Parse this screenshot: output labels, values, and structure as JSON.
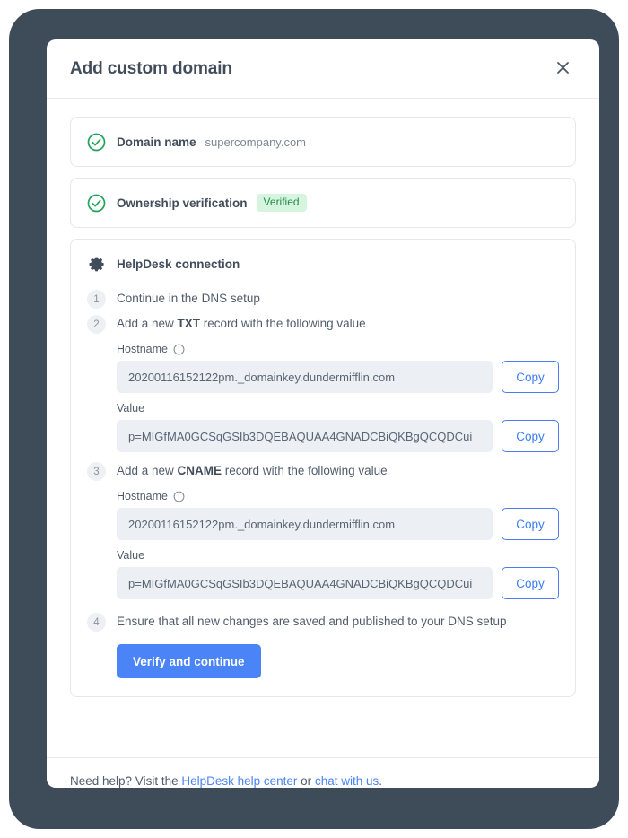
{
  "modal": {
    "title": "Add custom domain",
    "close_icon": "close-icon"
  },
  "summary": [
    {
      "icon": "check-circle-icon",
      "label": "Domain name",
      "value": "supercompany.com"
    },
    {
      "icon": "check-circle-icon",
      "label": "Ownership verification",
      "badge": "Verified"
    }
  ],
  "connection": {
    "icon": "gear-icon",
    "title": "HelpDesk connection",
    "steps": [
      {
        "num": "1",
        "text_before": "Continue in the DNS setup",
        "strong": "",
        "text_after": ""
      },
      {
        "num": "2",
        "text_before": "Add a new ",
        "strong": "TXT",
        "text_after": " record with the following value"
      },
      {
        "num": "3",
        "text_before": "Add a new ",
        "strong": "CNAME",
        "text_after": " record with the following value"
      },
      {
        "num": "4",
        "text_before": "Ensure that all new changes are saved and published to your DNS setup",
        "strong": "",
        "text_after": ""
      }
    ],
    "txt_record": {
      "hostname_label": "Hostname",
      "hostname_value": "20200116152122pm._domainkey.dundermifflin.com",
      "value_label": "Value",
      "value_value": "p=MIGfMA0GCSqGSIb3DQEBAQUAA4GNADCBiQKBgQCQDCui",
      "copy_label": "Copy",
      "info_icon": "info-icon"
    },
    "cname_record": {
      "hostname_label": "Hostname",
      "hostname_value": "20200116152122pm._domainkey.dundermifflin.com",
      "value_label": "Value",
      "value_value": "p=MIGfMA0GCSqGSIb3DQEBAQUAA4GNADCBiQKBgQCQDCui",
      "copy_label": "Copy",
      "info_icon": "info-icon"
    },
    "verify_button": "Verify and continue"
  },
  "footer": {
    "text_start": "Need help? Visit the ",
    "link_help_center": "HelpDesk help center",
    "text_middle": " or ",
    "link_chat": "chat with us",
    "text_end": "."
  },
  "colors": {
    "accent_blue": "#4a84f7",
    "success_green": "#22a35c",
    "badge_bg": "#d6f5de",
    "badge_text": "#248a47",
    "frame_dark": "#3e4b59",
    "text_dark": "#424d5c",
    "text_muted": "#7d8894",
    "input_bg": "#eceff3"
  }
}
